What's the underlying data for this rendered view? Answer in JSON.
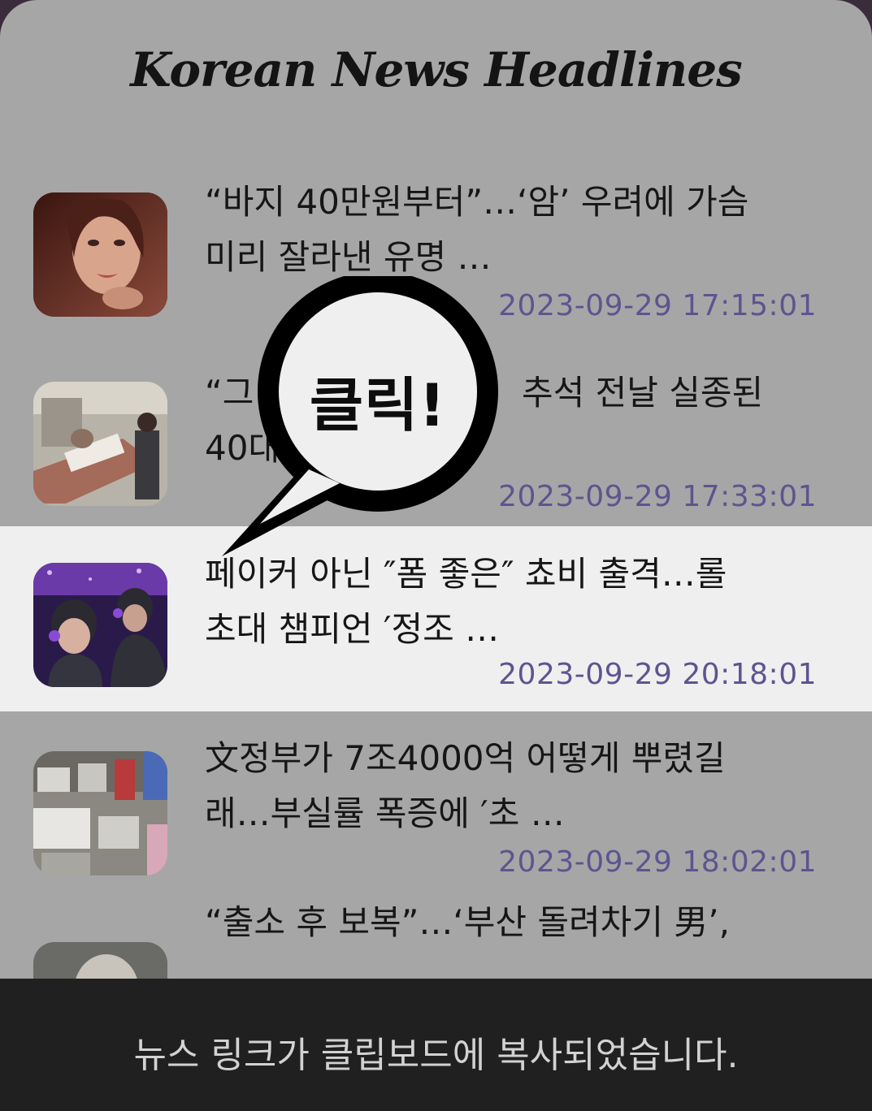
{
  "app": {
    "title": "Korean News Headlines"
  },
  "news": [
    {
      "headline_line1": "“바지 40만원부터”…‘암’ 우려에 가슴",
      "headline_line2": "미리 잘라낸 유명 …",
      "timestamp": "2023-09-29 17:15:01",
      "thumbnail": "portrait-woman"
    },
    {
      "headline_line1": "“그",
      "headline_line1_right": "추석 전날 실종된",
      "headline_line2": "40대",
      "timestamp": "2023-09-29 17:33:01",
      "thumbnail": "hospital-patient"
    },
    {
      "headline_line1": "페이커 아닌 ″폼 좋은″ 쵸비 출격…롤",
      "headline_line2": "초대 챔피언 ′정조 …",
      "timestamp": "2023-09-29 20:18:01",
      "thumbnail": "esports-players"
    },
    {
      "headline_line1": "文정부가 7조4000억 어떻게 뿌렸길",
      "headline_line2": "래…부실률 폭증에 ′초 …",
      "timestamp": "2023-09-29 18:02:01",
      "thumbnail": "factory"
    },
    {
      "headline_line1": "“출소 후 보복”…‘부산 돌려차기 男’,",
      "thumbnail": "person"
    }
  ],
  "overlay": {
    "bubble_text": "클릭!"
  },
  "toast": {
    "message": "뉴스 링크가 클립보드에 복사되었습니다."
  },
  "colors": {
    "background": "#a6a6a6",
    "selected_row": "#efefef",
    "timestamp": "#5c5590",
    "toast": "#202020"
  }
}
